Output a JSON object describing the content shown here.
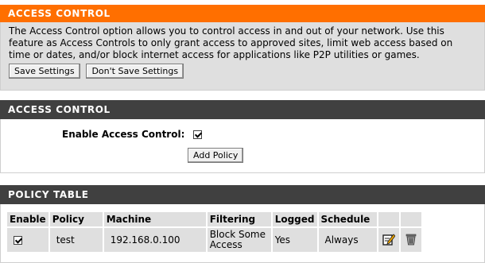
{
  "intro": {
    "title": "ACCESS CONTROL",
    "description_lines": [
      "The Access Control option allows you to control access in and out of your network. Use this",
      "feature as Access Controls to only grant access to approved sites, limit web access based on",
      "time or dates, and/or block internet access for applications like P2P utilities or games."
    ],
    "save_label": "Save Settings",
    "dont_save_label": "Don't Save Settings"
  },
  "access_control": {
    "title": "ACCESS CONTROL",
    "enable_label": "Enable Access Control:",
    "enabled": true,
    "add_policy_label": "Add Policy"
  },
  "policy_table": {
    "title": "POLICY TABLE",
    "columns": [
      "Enable",
      "Policy",
      "Machine",
      "Filtering",
      "Logged",
      "Schedule"
    ],
    "rows": [
      {
        "enabled": true,
        "policy": "test",
        "machine": "192.168.0.100",
        "filtering_lines": [
          "Block Some",
          "Access"
        ],
        "logged": "Yes",
        "schedule": "Always",
        "edit_icon": "edit-icon",
        "delete_icon": "trash-icon"
      }
    ]
  }
}
